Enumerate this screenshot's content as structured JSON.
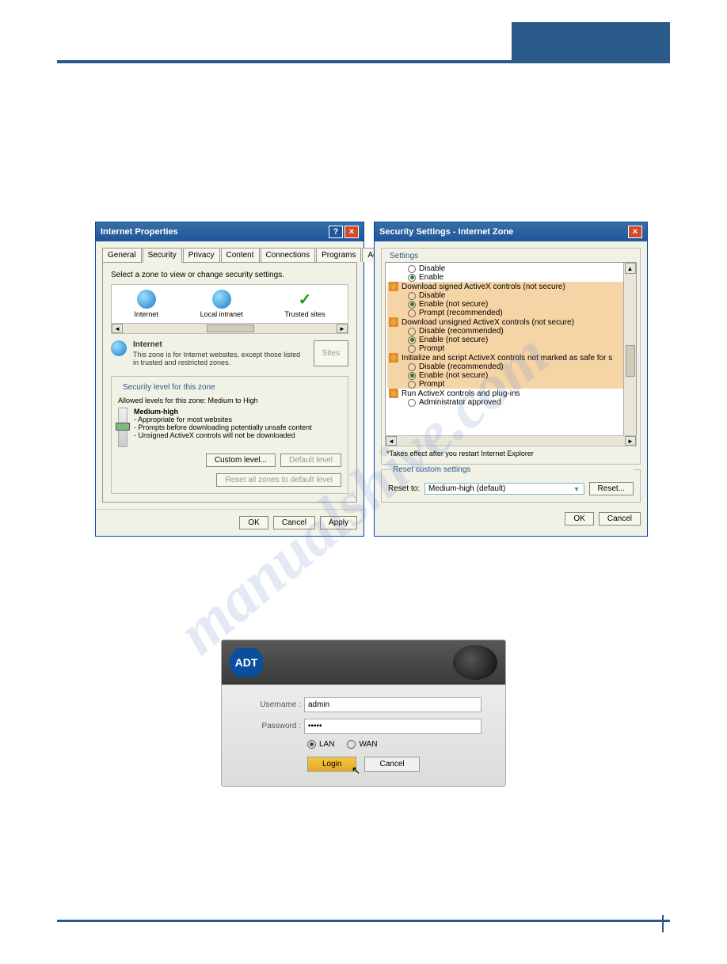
{
  "watermark": "manualshive.com",
  "internetProperties": {
    "title": "Internet Properties",
    "tabs": [
      "General",
      "Security",
      "Privacy",
      "Content",
      "Connections",
      "Programs",
      "Advanced"
    ],
    "activeTab": 1,
    "selectLabel": "Select a zone to view or change security settings.",
    "zones": [
      {
        "name": "Internet",
        "icon": "globe"
      },
      {
        "name": "Local intranet",
        "icon": "globe"
      },
      {
        "name": "Trusted sites",
        "icon": "check"
      }
    ],
    "zoneInfo": {
      "name": "Internet",
      "desc": "This zone is for Internet websites, except those listed in trusted and restricted zones."
    },
    "sitesBtn": "Sites",
    "securityFs": {
      "title": "Security level for this zone",
      "allowed": "Allowed levels for this zone: Medium to High",
      "levelName": "Medium-high",
      "bullets": [
        "Appropriate for most websites",
        "Prompts before downloading potentially unsafe content",
        "Unsigned ActiveX controls will not be downloaded"
      ],
      "customBtn": "Custom level...",
      "defaultBtn": "Default level",
      "resetBtn": "Reset all zones to default level"
    },
    "ok": "OK",
    "cancel": "Cancel",
    "apply": "Apply"
  },
  "securitySettings": {
    "title": "Security Settings - Internet Zone",
    "settingsLabel": "Settings",
    "tree": [
      {
        "type": "opt",
        "label": "Disable",
        "checked": false,
        "hl": false
      },
      {
        "type": "opt",
        "label": "Enable",
        "checked": true,
        "hl": false
      },
      {
        "type": "group",
        "label": "Download signed ActiveX controls (not secure)",
        "hl": true
      },
      {
        "type": "opt",
        "label": "Disable",
        "checked": false,
        "hl": true
      },
      {
        "type": "opt",
        "label": "Enable (not secure)",
        "checked": true,
        "hl": true
      },
      {
        "type": "opt",
        "label": "Prompt (recommended)",
        "checked": false,
        "hl": true
      },
      {
        "type": "group",
        "label": "Download unsigned ActiveX controls (not secure)",
        "hl": true
      },
      {
        "type": "opt",
        "label": "Disable (recommended)",
        "checked": false,
        "hl": true
      },
      {
        "type": "opt",
        "label": "Enable (not secure)",
        "checked": true,
        "hl": true
      },
      {
        "type": "opt",
        "label": "Prompt",
        "checked": false,
        "hl": true
      },
      {
        "type": "group",
        "label": "Initialize and script ActiveX controls not marked as safe for s",
        "hl": true
      },
      {
        "type": "opt",
        "label": "Disable (recommended)",
        "checked": false,
        "hl": true
      },
      {
        "type": "opt",
        "label": "Enable (not secure)",
        "checked": true,
        "hl": true
      },
      {
        "type": "opt",
        "label": "Prompt",
        "checked": false,
        "hl": true
      },
      {
        "type": "group",
        "label": "Run ActiveX controls and plug-ins",
        "hl": false
      },
      {
        "type": "opt",
        "label": "Administrator approved",
        "checked": false,
        "hl": false
      }
    ],
    "note": "*Takes effect after you restart Internet Explorer",
    "resetFs": {
      "title": "Reset custom settings",
      "label": "Reset to:",
      "value": "Medium-high (default)",
      "btn": "Reset..."
    },
    "ok": "OK",
    "cancel": "Cancel"
  },
  "login": {
    "brand": "ADT",
    "usernameLabel": "Username :",
    "usernameValue": "admin",
    "passwordLabel": "Password :",
    "passwordValue": "•••••",
    "lan": "LAN",
    "wan": "WAN",
    "loginBtn": "Login",
    "cancelBtn": "Cancel"
  }
}
